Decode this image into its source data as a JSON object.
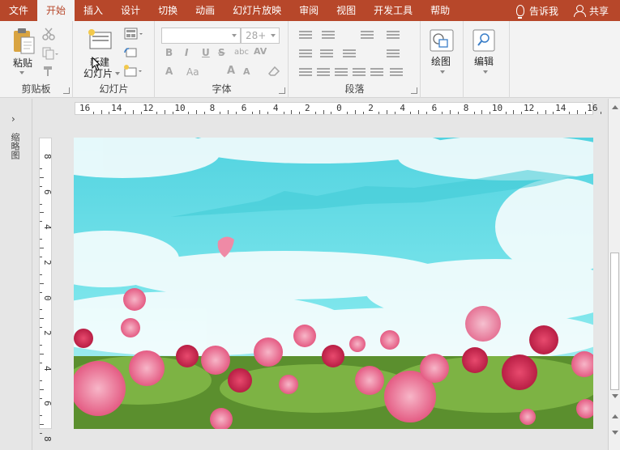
{
  "tabs": [
    "文件",
    "开始",
    "插入",
    "设计",
    "切换",
    "动画",
    "幻灯片放映",
    "审阅",
    "视图",
    "开发工具",
    "帮助"
  ],
  "tell_me": "告诉我",
  "share": "共享",
  "ribbon": {
    "clipboard": {
      "paste_label": "粘贴",
      "group_label": "剪贴板"
    },
    "slides": {
      "new_slide_line1": "新建",
      "new_slide_line2": "幻灯片",
      "group_label": "幻灯片"
    },
    "font": {
      "font_size": "28+",
      "bold": "B",
      "italic": "I",
      "underline": "U",
      "strike": "S",
      "shadow": "abc",
      "spacing": "AV",
      "font_color": "A",
      "change_case": "Aa",
      "grow": "A",
      "shrink": "A",
      "group_label": "字体"
    },
    "paragraph": {
      "group_label": "段落"
    },
    "drawing": {
      "label": "绘图"
    },
    "editing": {
      "label": "编辑"
    }
  },
  "left_pane": {
    "label": "缩略图"
  },
  "ruler_h": [
    "16",
    "14",
    "12",
    "10",
    "8",
    "6",
    "4",
    "2",
    "0",
    "2",
    "4",
    "6",
    "8",
    "10",
    "12",
    "14",
    "16"
  ],
  "ruler_v": [
    "8",
    "6",
    "4",
    "2",
    "0",
    "2",
    "4",
    "6",
    "8"
  ],
  "colors": {
    "accent": "#b7472a",
    "sky": "#4fd6e0",
    "ribbon_bg": "#f3f3f3"
  }
}
